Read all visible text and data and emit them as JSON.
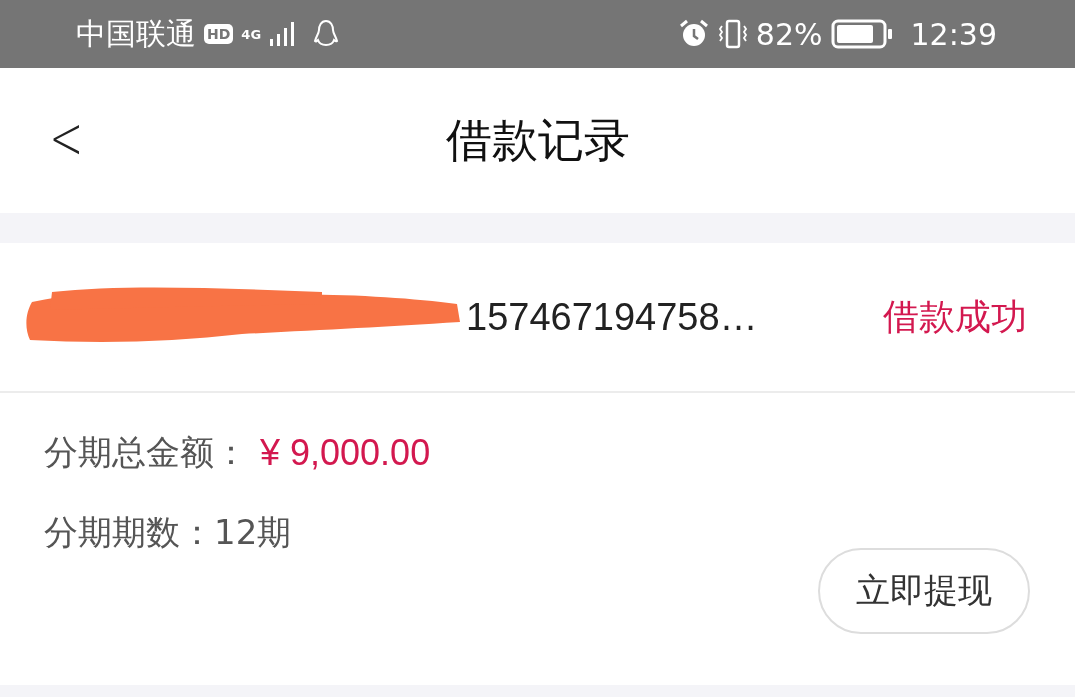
{
  "status_bar": {
    "carrier": "中国联通",
    "hd_badge": "HD",
    "network": "4G",
    "battery_percent": "82%",
    "time": "12:39"
  },
  "header": {
    "back": "<",
    "title": "借款记录"
  },
  "record": {
    "order_number": "157467194758…",
    "status": "借款成功",
    "total_label": "分期总金额：",
    "total_amount": "¥ 9,000.00",
    "periods_label": "分期期数：",
    "periods_value": "12期",
    "action": "立即提现"
  }
}
